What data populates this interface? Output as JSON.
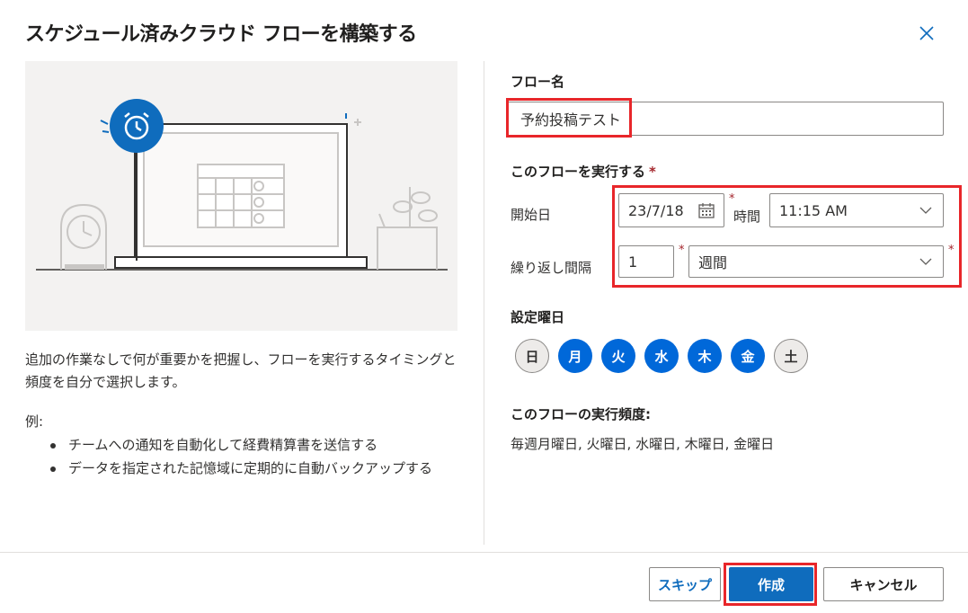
{
  "dialog": {
    "title": "スケジュール済みクラウド フローを構築する"
  },
  "description": "追加の作業なしで何が重要かを把握し、フローを実行するタイミングと頻度を自分で選択します。",
  "examples": {
    "label": "例:",
    "items": [
      "チームへの通知を自動化して経費精算書を送信する",
      "データを指定された記憶域に定期的に自動バックアップする"
    ]
  },
  "form": {
    "flow_name_label": "フロー名",
    "flow_name_value": "予約投稿テスト",
    "run_section_label": "このフローを実行する",
    "required_mark": "*",
    "start_date_label": "開始日",
    "start_date_value": "23/7/18",
    "time_label": "時間",
    "time_value": "11:15 AM",
    "repeat_label": "繰り返し間隔",
    "repeat_count": "1",
    "repeat_unit": "週間",
    "weekday_label": "設定曜日",
    "weekdays": [
      {
        "label": "日",
        "selected": false
      },
      {
        "label": "月",
        "selected": true
      },
      {
        "label": "火",
        "selected": true
      },
      {
        "label": "水",
        "selected": true
      },
      {
        "label": "木",
        "selected": true
      },
      {
        "label": "金",
        "selected": true
      },
      {
        "label": "土",
        "selected": false
      }
    ],
    "frequency_label": "このフローの実行頻度:",
    "frequency_value": "毎週月曜日, 火曜日, 水曜日, 木曜日, 金曜日"
  },
  "buttons": {
    "skip": "スキップ",
    "create": "作成",
    "cancel": "キャンセル"
  },
  "colors": {
    "accent": "#0f6cbd",
    "highlight": "#e8262a",
    "required": "#a4262c"
  }
}
